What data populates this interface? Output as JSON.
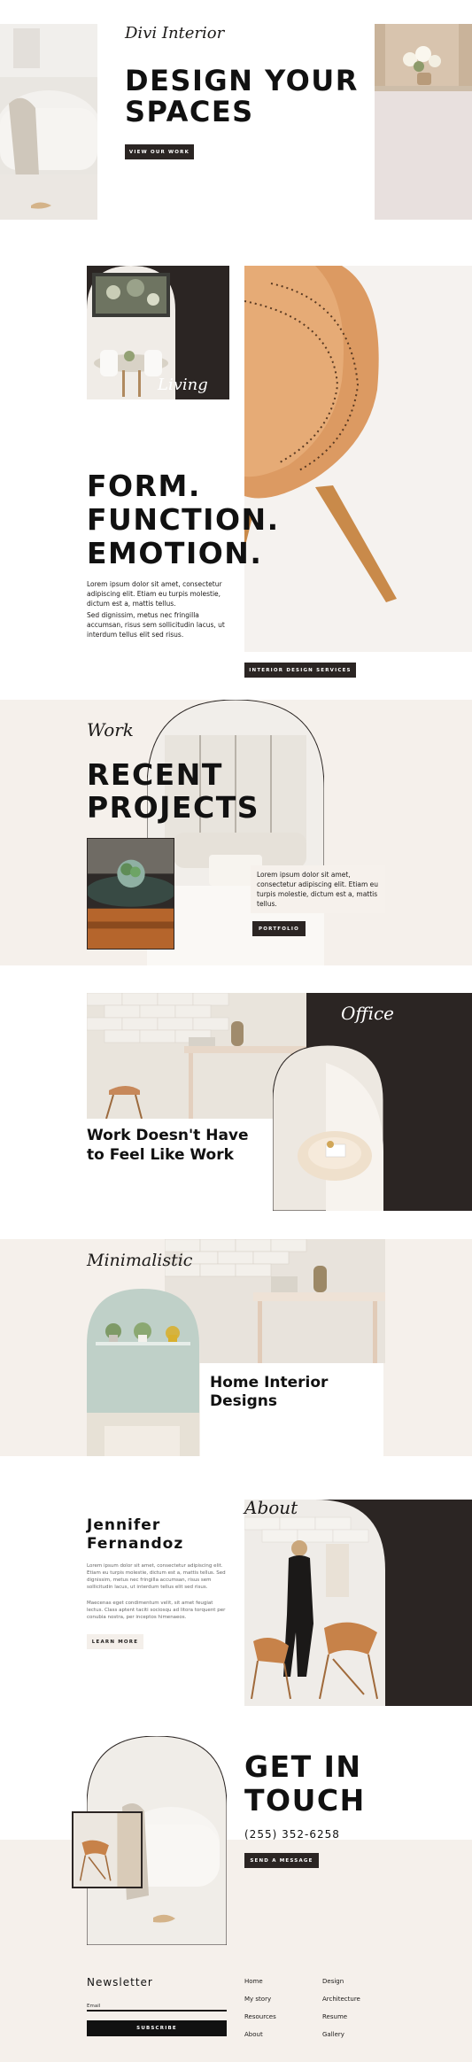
{
  "hero": {
    "script_brand": "Divi Interior",
    "headline_line1": "DESIGN YOUR",
    "headline_line2": "SPACES",
    "button": "VIEW OUR WORK"
  },
  "form_section": {
    "script_label": "Living",
    "headline_line1": "FORM.",
    "headline_line2": "FUNCTION.",
    "headline_line3": "EMOTION.",
    "paragraph1": "Lorem ipsum dolor sit amet, consectetur adipiscing elit. Etiam eu turpis molestie, dictum est a, mattis tellus.",
    "paragraph2": "Sed dignissim, metus nec fringilla accumsan, risus sem sollicitudin lacus, ut interdum tellus elit sed risus.",
    "button": "INTERIOR DESIGN SERVICES"
  },
  "projects": {
    "script_label": "Work",
    "headline_line1": "RECENT",
    "headline_line2": "PROJECTS",
    "card_text": "Lorem ipsum dolor sit amet, consectetur adipiscing elit. Etiam eu turpis molestie, dictum est a, mattis tellus.",
    "button": "PORTFOLIO"
  },
  "office": {
    "script_label": "Office",
    "heading_line1": "Work Doesn't Have",
    "heading_line2": "to Feel Like Work"
  },
  "minimalistic": {
    "script_label": "Minimalistic",
    "heading_line1": "Home Interior",
    "heading_line2": "Designs"
  },
  "about": {
    "script_label": "About",
    "name_line1": "Jennifer",
    "name_line2": "Fernandoz",
    "paragraph1": "Lorem ipsum dolor sit amet, consectetur adipiscing elit. Etiam eu turpis molestie, dictum est a, mattis tellus. Sed dignissim, metus nec fringilla accumsan, risus sem sollicitudin lacus, ut interdum tellus elit sed risus.",
    "paragraph2": "Maecenas eget condimentum velit, sit amet feugiat lectus. Class aptent taciti sociosqu ad litora torquent per conubia nostra, per inceptos himenaeos.",
    "button": "LEARN MORE"
  },
  "contact": {
    "headline_line1": "GET IN",
    "headline_line2": "TOUCH",
    "phone": "(255) 352-6258",
    "button": "SEND A MESSAGE"
  },
  "footer": {
    "newsletter_title": "Newsletter",
    "email_label": "Email",
    "subscribe_button": "SUBSCRIBE",
    "links_col1": [
      "Home",
      "My story",
      "Resources",
      "About"
    ],
    "links_col2": [
      "Design",
      "Architecture",
      "Resume",
      "Gallery"
    ]
  },
  "colors": {
    "dark": "#2b2523",
    "beige": "#f5f0eb",
    "leather": "#d9925c"
  }
}
